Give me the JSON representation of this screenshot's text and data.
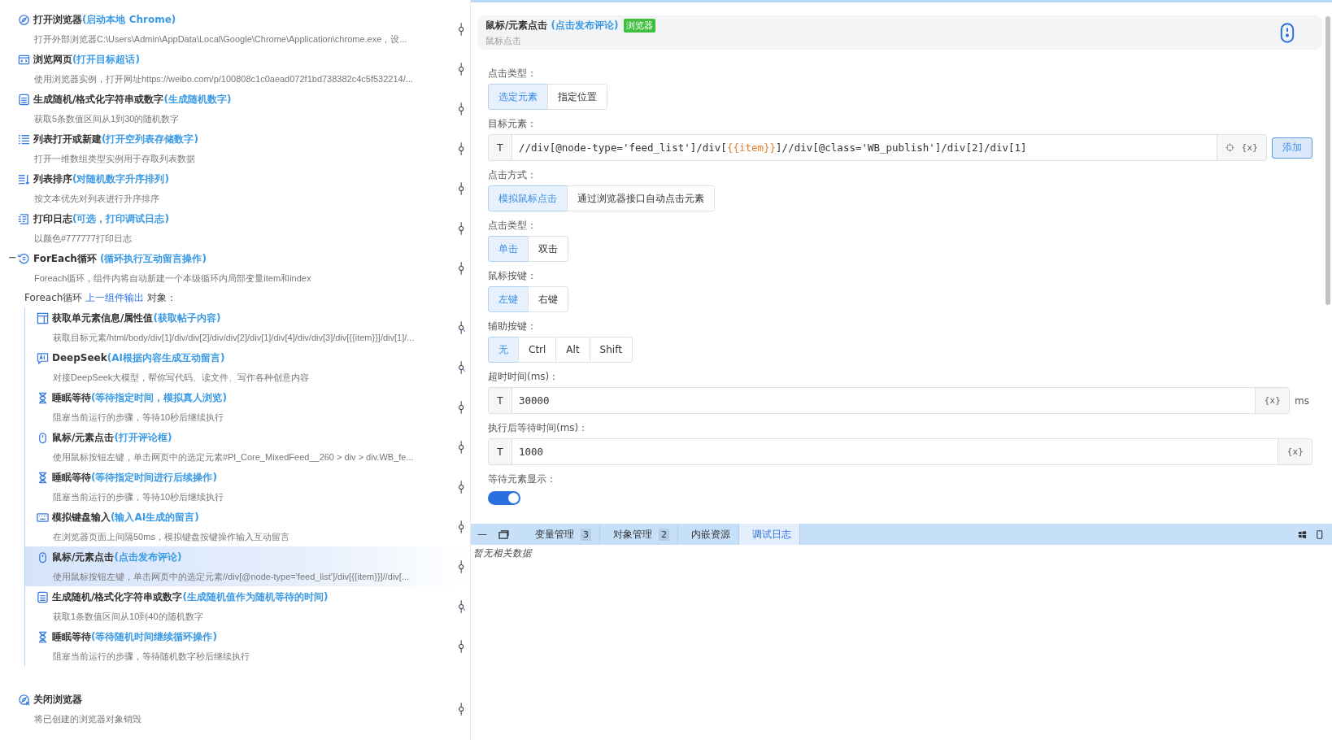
{
  "flow": {
    "steps": [
      {
        "kind": "browser",
        "title": "打开浏览器",
        "note": "(启动本地 Chrome)",
        "desc": "打开外部浏览器C:\\Users\\Admin\\AppData\\Local\\Google\\Chrome\\Application\\chrome.exe，设...",
        "branched": false,
        "selected": false
      },
      {
        "kind": "webpage",
        "title": "浏览网页",
        "note": "(打开目标超话)",
        "desc": "使用浏览器实例，打开网址https://weibo.com/p/100808c1c0aead072f1bd738382c4c5f532214/...",
        "branched": false,
        "selected": false
      },
      {
        "kind": "random",
        "title": "生成随机/格式化字符串或数字",
        "note": "(生成随机数字)",
        "desc": "获取5条数值区间从1到30的随机数字",
        "branched": false,
        "selected": false
      },
      {
        "kind": "list",
        "title": "列表打开或新建",
        "note": "(打开空列表存储数字)",
        "desc": "打开一维数组类型实例用于存取列表数据",
        "branched": false,
        "selected": false
      },
      {
        "kind": "sort",
        "title": "列表排序",
        "note": "(对随机数字升序排列)",
        "desc": "按文本优先对列表进行升序排序",
        "branched": false,
        "selected": false
      },
      {
        "kind": "log",
        "title": "打印日志",
        "note": "(可选，打印调试日志)",
        "desc": "以颜色#777777打印日志",
        "branched": false,
        "selected": false
      },
      {
        "kind": "loop",
        "toggle": "−",
        "title": "ForEach循环",
        "note": " (循环执行互动留言操作)",
        "desc": "Foreach循环，组件内将自动新建一个本级循环内局部变量item和index",
        "branched": false,
        "selected": false,
        "loop_header": {
          "before": "Foreach循环",
          "link": "上一组件输出",
          "after": "对象："
        },
        "children": [
          {
            "kind": "element",
            "title": "获取单元素信息/属性值",
            "note": "(获取帖子内容)",
            "desc": "获取目标元素/html/body/div[1]/div/div[2]/div/div[2]/div[1]/div[4]/div/div[3]/div[{{item}}]/div[1]/...",
            "branched": true,
            "selected": false
          },
          {
            "kind": "ai",
            "title": "DeepSeek",
            "note": "(AI根据内容生成互动留言)",
            "desc": "对接DeepSeek大模型，帮你写代码、读文件、写作各种创意内容",
            "branched": true,
            "selected": false
          },
          {
            "kind": "hourglass",
            "title": "睡眠等待",
            "note": "(等待指定时间，模拟真人浏览)",
            "desc": "阻塞当前运行的步骤，等待10秒后继续执行",
            "branched": false,
            "selected": false
          },
          {
            "kind": "mouse",
            "title": "鼠标/元素点击",
            "note": "(打开评论框)",
            "desc": "使用鼠标按钮左键，单击网页中的选定元素#Pl_Core_MixedFeed__260 > div > div.WB_fe...",
            "branched": false,
            "selected": false
          },
          {
            "kind": "hourglass",
            "title": "睡眠等待",
            "note": "(等待指定时间进行后续操作)",
            "desc": "阻塞当前运行的步骤，等待10秒后继续执行",
            "branched": false,
            "selected": false
          },
          {
            "kind": "keyboard",
            "title": "模拟键盘输入",
            "note": "(输入AI生成的留言)",
            "desc": "在浏览器页面上间隔50ms，模拟键盘按键操作输入互动留言",
            "branched": false,
            "selected": false
          },
          {
            "kind": "mouse",
            "title": "鼠标/元素点击",
            "note": "(点击发布评论)",
            "desc": "使用鼠标按钮左键，单击网页中的选定元素//div[@node-type='feed_list']/div[{{item}}]//div[...",
            "branched": false,
            "selected": true
          },
          {
            "kind": "random",
            "title": "生成随机/格式化字符串或数字",
            "note": "(生成随机值作为随机等待的时间)",
            "desc": "获取1条数值区间从10到40的随机数字",
            "branched": true,
            "selected": false
          },
          {
            "kind": "hourglass",
            "title": "睡眠等待",
            "note": "(等待随机时间继续循环操作)",
            "desc": "阻塞当前运行的步骤，等待随机数字秒后继续执行",
            "branched": false,
            "selected": false
          }
        ]
      },
      {
        "kind": "close-browser",
        "title": "关闭浏览器",
        "desc": "将已创建的浏览器对象销毁",
        "branched": false,
        "selected": false
      }
    ]
  },
  "editor": {
    "header": {
      "title": "鼠标/元素点击",
      "note": "(点击发布评论)",
      "tag": "浏览器",
      "subtitle": "鼠标点击"
    },
    "fields": [
      {
        "kind": "segmented",
        "label": "点击类型：",
        "options": [
          {
            "label": "选定元素",
            "selected": true
          },
          {
            "label": "指定位置",
            "selected": false
          }
        ]
      },
      {
        "kind": "xpath",
        "label": "目标元素：",
        "prefix": "T",
        "before": "//div[@node-type='feed_list']/div[",
        "variable": "{{item}}",
        "after": "]//div[@class='WB_publish']/div[2]/div[1]",
        "var_button": "{x}",
        "action": "添加"
      },
      {
        "kind": "segmented",
        "label": "点击方式：",
        "options": [
          {
            "label": "模拟鼠标点击",
            "selected": true
          },
          {
            "label": "通过浏览器接口自动点击元素",
            "selected": false
          }
        ]
      },
      {
        "kind": "segmented",
        "label": "点击类型：",
        "options": [
          {
            "label": "单击",
            "selected": true
          },
          {
            "label": "双击",
            "selected": false
          }
        ]
      },
      {
        "kind": "segmented",
        "label": "鼠标按键：",
        "options": [
          {
            "label": "左键",
            "selected": true
          },
          {
            "label": "右键",
            "selected": false
          }
        ]
      },
      {
        "kind": "segmented",
        "label": "辅助按键：",
        "options": [
          {
            "label": "无",
            "selected": true
          },
          {
            "label": "Ctrl",
            "selected": false
          },
          {
            "label": "Alt",
            "selected": false
          },
          {
            "label": "Shift",
            "selected": false
          }
        ]
      },
      {
        "kind": "input",
        "label": "超时时间(ms)：",
        "prefix": "T",
        "value": "30000",
        "var_button": "{x}",
        "unit": "ms"
      },
      {
        "kind": "input",
        "label": "执行后等待时间(ms)：",
        "prefix": "T",
        "value": "1000",
        "var_button": "{x}"
      },
      {
        "kind": "switch",
        "label": "等待元素显示：",
        "on": true
      }
    ]
  },
  "dock": {
    "minimize": "—",
    "tabs": [
      {
        "label": "变量管理",
        "count": "3",
        "selected": false
      },
      {
        "label": "对象管理",
        "count": "2",
        "selected": false
      },
      {
        "label": "内嵌资源",
        "selected": false
      },
      {
        "label": "调试日志",
        "selected": true
      }
    ],
    "empty": "暂无相关数据"
  }
}
